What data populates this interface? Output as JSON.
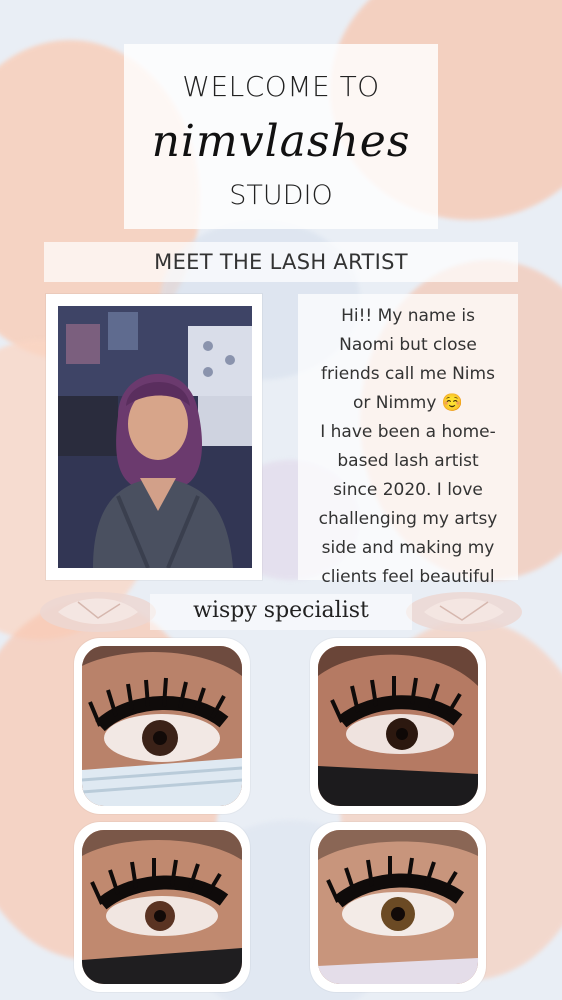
{
  "header": {
    "welcome": "WELCOME TO",
    "brand": "nimvlashes",
    "studio": "STUDIO"
  },
  "section_title": "MEET THE LASH ARTIST",
  "bio_lines": [
    "Hi!! My name is",
    "Naomi but close",
    "friends call me Nims",
    "or Nimmy ☺️",
    "I have been a home-",
    "based lash artist",
    "since 2020. I love",
    "challenging my artsy",
    "side and making my",
    "clients feel beautiful"
  ],
  "tagline": "wispy specialist",
  "colors": {
    "peach": "#f7c2a8",
    "light_blue": "#d9e3ef",
    "lavender": "#dcd6ea",
    "text_dark": "#222222"
  }
}
